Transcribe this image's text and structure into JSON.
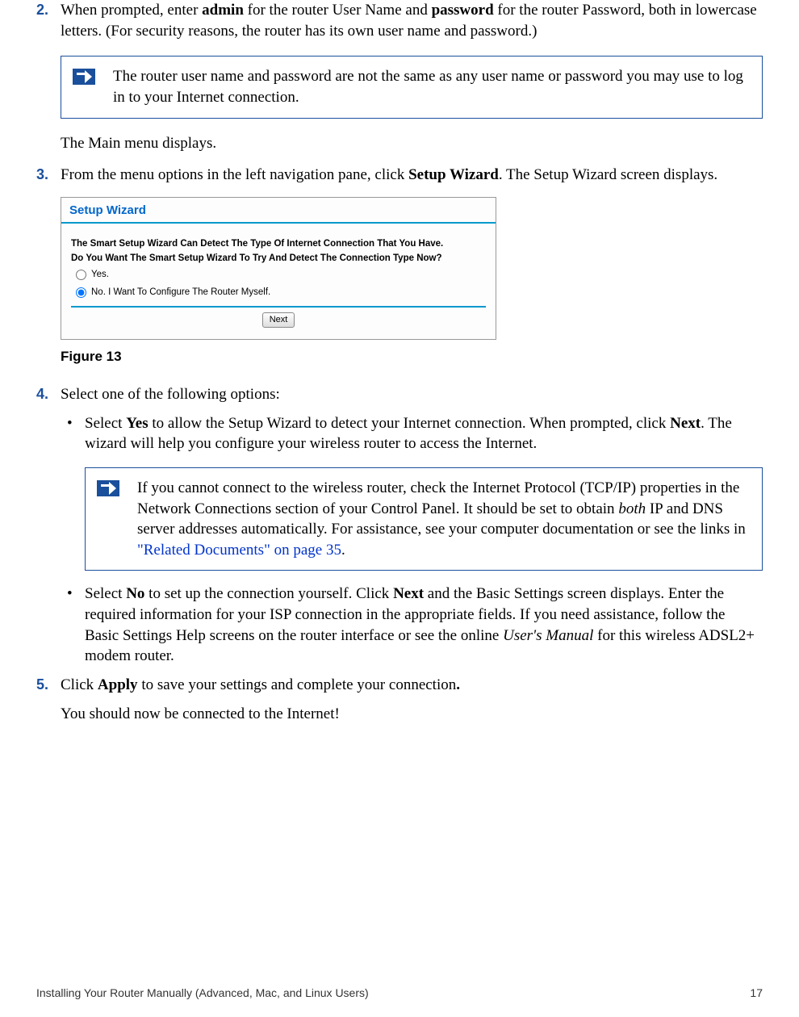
{
  "step2": {
    "num": "2.",
    "text_a": "When prompted, enter ",
    "admin": "admin",
    "text_b": " for the router User Name and ",
    "password": "password",
    "text_c": " for the router Password, both in lowercase letters. (For security reasons, the router has its own user name and password.)"
  },
  "note1": "The router user name and password are not the same as any user name or password you may use to log in to your Internet connection.",
  "main_menu": "The Main menu displays.",
  "step3": {
    "num": "3.",
    "text_a": "From the menu options in the left navigation pane, click ",
    "bold": "Setup Wizard",
    "text_b": ". The Setup Wizard screen displays."
  },
  "figure": {
    "header": "Setup Wizard",
    "line1": "The Smart Setup Wizard Can Detect The Type Of Internet Connection That You Have.",
    "line2": "Do You Want The Smart Setup Wizard To Try And Detect The Connection Type Now?",
    "radio_yes": "Yes.",
    "radio_no": "No. I Want To Configure The Router Myself.",
    "next": "Next"
  },
  "figure_caption": "Figure 13",
  "step4": {
    "num": "4.",
    "text": "Select one of the following options:"
  },
  "bullet1": {
    "mark": "•",
    "a": "Select ",
    "yes": "Yes",
    "b": " to allow the Setup Wizard to detect your Internet connection. When prompted, click ",
    "next": "Next",
    "c": ". The wizard will help you configure your wireless router to access the Internet."
  },
  "note2": {
    "a": "If you cannot connect to the wireless router, check the Internet Protocol (TCP/IP) properties in the Network Connections section of your Control Panel. It should be set to obtain ",
    "both": "both",
    "b": " IP and DNS server addresses automatically. For assistance, see your computer documentation or see the links in  ",
    "link": "\"Related Documents\" on page 35",
    "c": "."
  },
  "bullet2": {
    "mark": "•",
    "a": "Select ",
    "no": "No",
    "b": " to set up the connection yourself. Click ",
    "next": "Next",
    "c": " and the Basic Settings screen displays. Enter the required information for your ISP connection in the appropriate fields. If you need assistance, follow the Basic Settings Help screens on the router interface or see the online ",
    "manual": "User's Manual",
    "d": " for this wireless ADSL2+ modem router."
  },
  "step5": {
    "num": "5.",
    "a": "Click ",
    "apply": "Apply",
    "b": " to save your settings and complete your connection",
    "dot": "."
  },
  "connected": "You should now be connected to the Internet!",
  "footer_left": "Installing Your Router Manually (Advanced, Mac, and Linux Users)",
  "footer_right": "17"
}
